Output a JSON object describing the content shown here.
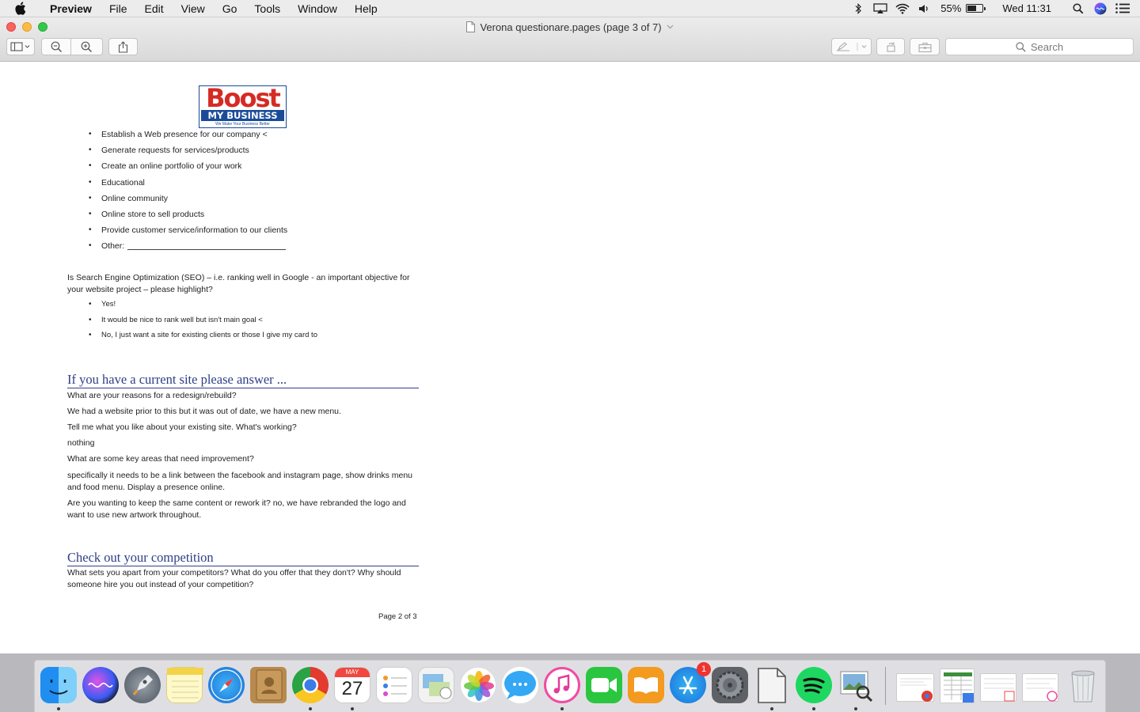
{
  "menubar": {
    "app_name": "Preview",
    "items": [
      "File",
      "Edit",
      "View",
      "Go",
      "Tools",
      "Window",
      "Help"
    ],
    "battery": "55%",
    "battery_level": 0.55,
    "clock": "Wed 11:31"
  },
  "window": {
    "title": "Verona questionare.pages (page 3 of 7)",
    "search_placeholder": "Search"
  },
  "document": {
    "logo": {
      "main": "Boost",
      "sub": "MY BUSINESS",
      "tagline": "We Make Your Business Better"
    },
    "goal_bullets": [
      "Establish a Web presence for our company <",
      "Generate requests for services/products",
      "Create an online portfolio of your work",
      "Educational",
      "Online community",
      "Online store to sell products",
      "Provide customer service/information to our clients"
    ],
    "other_label": "Other:",
    "seo_question": "Is Search Engine Optimization (SEO) – i.e. ranking well in Google - an important objective for your website project – please highlight?",
    "seo_options": [
      "Yes!",
      "It would be nice to rank well but isn't main goal <",
      "No, I just want a site for existing clients or those I give my card to"
    ],
    "current_site_heading": "If you have a current site please answer ...",
    "current_site_lines": [
      "What are your reasons for a redesign/rebuild?",
      "We had a website prior to this but it was out of date, we have a new menu.",
      "Tell me what you like about your existing site. What's working?",
      "nothing",
      "What are some key areas that need improvement?",
      "specifically it needs to be a link between the facebook and instagram page, show drinks menu and food menu. Display a presence online.",
      "Are you wanting to keep the same content or rework it? no, we have rebranded the logo and want to use new artwork throughout."
    ],
    "competition_heading": "Check out your competition",
    "competition_text": "What sets you apart from your competitors? What do you offer that they don't? Why should someone hire you out instead of your competition?",
    "page_number": "Page 2 of 3"
  },
  "dock": {
    "calendar_month": "MAY",
    "calendar_day": "27",
    "app_store_badge": "1"
  }
}
